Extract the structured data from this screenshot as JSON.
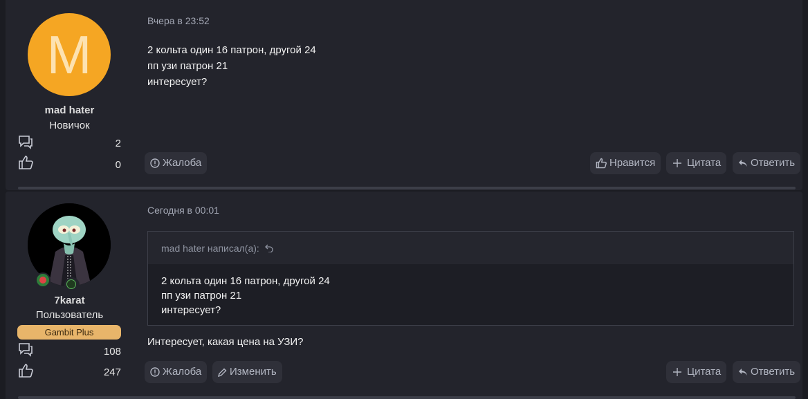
{
  "posts": [
    {
      "avatar_letter": "M",
      "username": "mad hater",
      "rank": "Новичок",
      "messages_count": "2",
      "likes_count": "0",
      "date": "Вчера в 23:52",
      "lines": [
        "2 кольта один 16 патрон, другой 24",
        "пп узи патрон 21",
        "интересует?"
      ],
      "actions": {
        "report": "Жалоба",
        "like": "Нравится",
        "quote": "Цитата",
        "reply": "Ответить"
      }
    },
    {
      "username": "7karat",
      "rank": "Пользователь",
      "badge": "Gambit Plus",
      "messages_count": "108",
      "likes_count": "247",
      "date": "Сегодня в 00:01",
      "quote": {
        "author": "mad hater написал(а):",
        "lines": [
          "2 кольта один 16 патрон, другой 24",
          "пп узи патрон 21",
          "интересует?"
        ]
      },
      "text": "Интересует, какая цена на УЗИ?",
      "actions": {
        "report": "Жалоба",
        "edit": "Изменить",
        "quote": "Цитата",
        "reply": "Ответить"
      }
    }
  ],
  "colors": {
    "accent_avatar": "#f5a623",
    "badge": "#e8b56a",
    "background": "#23242c"
  },
  "icons": [
    "messages-icon",
    "likes-icon",
    "report-icon",
    "like-icon",
    "plus-icon",
    "reply-icon",
    "edit-icon",
    "undo-icon"
  ]
}
